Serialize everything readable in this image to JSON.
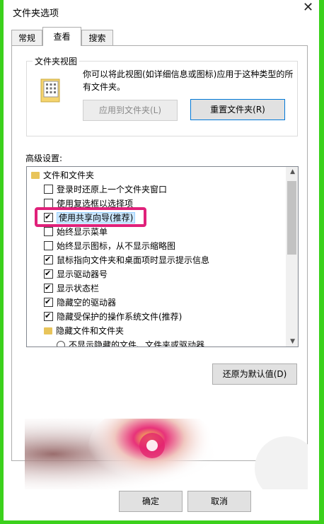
{
  "window": {
    "title": "文件夹选项",
    "close": "✕"
  },
  "tabs": [
    {
      "label": "常规"
    },
    {
      "label": "查看"
    },
    {
      "label": "搜索"
    }
  ],
  "folder_views": {
    "legend": "文件夹视图",
    "description": "你可以将此视图(如详细信息或图标)应用于这种类型的所有文件夹。",
    "apply_button": "应用到文件夹(L)",
    "reset_button": "重置文件夹(R)"
  },
  "advanced": {
    "label": "高级设置:",
    "items": [
      {
        "type": "folder",
        "label": "文件和文件夹"
      },
      {
        "type": "checkbox",
        "checked": false,
        "label": "登录时还原上一个文件夹窗口"
      },
      {
        "type": "checkbox",
        "checked": false,
        "label": "使用复选框以选择项"
      },
      {
        "type": "checkbox",
        "checked": true,
        "label": "使用共享向导(推荐)",
        "selected": true
      },
      {
        "type": "checkbox",
        "checked": false,
        "label": "始终显示菜单"
      },
      {
        "type": "checkbox",
        "checked": false,
        "label": "始终显示图标，从不显示缩略图"
      },
      {
        "type": "checkbox",
        "checked": true,
        "label": "鼠标指向文件夹和桌面项时显示提示信息"
      },
      {
        "type": "checkbox",
        "checked": true,
        "label": "显示驱动器号"
      },
      {
        "type": "checkbox",
        "checked": true,
        "label": "显示状态栏"
      },
      {
        "type": "checkbox",
        "checked": true,
        "label": "隐藏空的驱动器"
      },
      {
        "type": "checkbox",
        "checked": true,
        "label": "隐藏受保护的操作系统文件(推荐)"
      },
      {
        "type": "folder",
        "label": "隐藏文件和文件夹"
      },
      {
        "type": "radio",
        "label": "不显示隐藏的文件、文件夹或驱动器"
      }
    ],
    "restore_button": "还原为默认值(D)"
  },
  "footer": {
    "ok_button": "确定",
    "cancel_button": "取消"
  }
}
